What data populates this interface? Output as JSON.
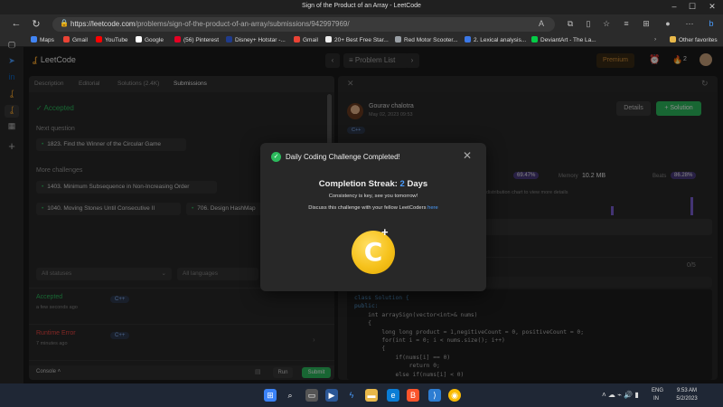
{
  "browser": {
    "title": "Sign of the Product of an Array - LeetCode",
    "url_main": "https://leetcode.com",
    "url_rest": "/problems/sign-of-the-product-of-an-array/submissions/942997969/",
    "bookmarks": [
      {
        "label": "Maps",
        "color": "#4285f4"
      },
      {
        "label": "Gmail",
        "color": "#ea4335"
      },
      {
        "label": "YouTube",
        "color": "#ff0000"
      },
      {
        "label": "Google",
        "color": "#ffffff"
      },
      {
        "label": "(56) Pinterest",
        "color": "#e60023"
      },
      {
        "label": "Disney+ Hotstar -...",
        "color": "#1f3b8c"
      },
      {
        "label": "Gmail",
        "color": "#ea4335"
      },
      {
        "label": "20+ Best Free Star...",
        "color": "#eeeeee"
      },
      {
        "label": "Red Motor Scooter...",
        "color": "#9aa0a6"
      },
      {
        "label": "2. Lexical analysis...",
        "color": "#3b78e7"
      },
      {
        "label": "DeviantArt - The La...",
        "color": "#05cc47"
      }
    ],
    "other_favorites": "Other favorites"
  },
  "leetcode": {
    "logo": "LeetCode",
    "problem_list": "Problem List",
    "premium": "Premium",
    "streak_count": "2"
  },
  "left": {
    "tabs": [
      "Description",
      "Editorial",
      "Solutions (2.4K)",
      "Submissions"
    ],
    "accepted": "Accepted",
    "next_question_label": "Next question",
    "next_question": "1823. Find the Winner of the Circular Game",
    "more_challenges_label": "More challenges",
    "challenges": [
      "1403. Minimum Subsequence in Non-Increasing Order",
      "1040. Moving Stones Until Consecutive II",
      "706. Design HashMap"
    ],
    "filter_status": "All statuses",
    "filter_lang": "All languages",
    "submissions": [
      {
        "status": "Accepted",
        "time": "a few seconds ago",
        "lang": "C++",
        "color": "#2cbb5d"
      },
      {
        "status": "Runtime Error",
        "time": "7 minutes ago",
        "lang": "C++",
        "color": "#ef4743"
      },
      {
        "status": "Runtime Error",
        "time": "8 minutes ago",
        "lang": "C++",
        "color": "#ef4743"
      }
    ],
    "console": "Console",
    "run": "Run",
    "submit": "Submit"
  },
  "right": {
    "user": "Gourav chalotra",
    "date": "May 02, 2023 09:53",
    "details": "Details",
    "solution": "+ Solution",
    "lang": "C++",
    "runtime_pct": "69.47%",
    "memory_label": "Memory",
    "memory_value": "10.2 MB",
    "beats_label": "Beats",
    "memory_pct": "86.28%",
    "dist_note": "distribution chart to view more details",
    "count": "0/5",
    "code": [
      "class Solution {",
      "public:",
      "    int arraySign(vector<int>& nums)",
      "    {",
      "        long long product = 1,negitiveCount = 0, positiveCount = 0;",
      "        for(int i = 0; i < nums.size(); i++)",
      "        {",
      "            if(nums[i] == 0)",
      "                return 0;",
      "            else if(nums[i] < 0)"
    ]
  },
  "modal": {
    "title": "Daily Coding Challenge Completed!",
    "streak_label": "Completion Streak:",
    "streak_value": "2",
    "streak_unit": "Days",
    "consistency": "Consistency is key, see you tomorrow!",
    "discuss": "Discuss this challenge with your fellow LeetCoders",
    "discuss_link": "here"
  },
  "taskbar": {
    "lang1": "ENG",
    "lang2": "IN",
    "time": "9:53 AM",
    "date": "5/2/2023"
  }
}
